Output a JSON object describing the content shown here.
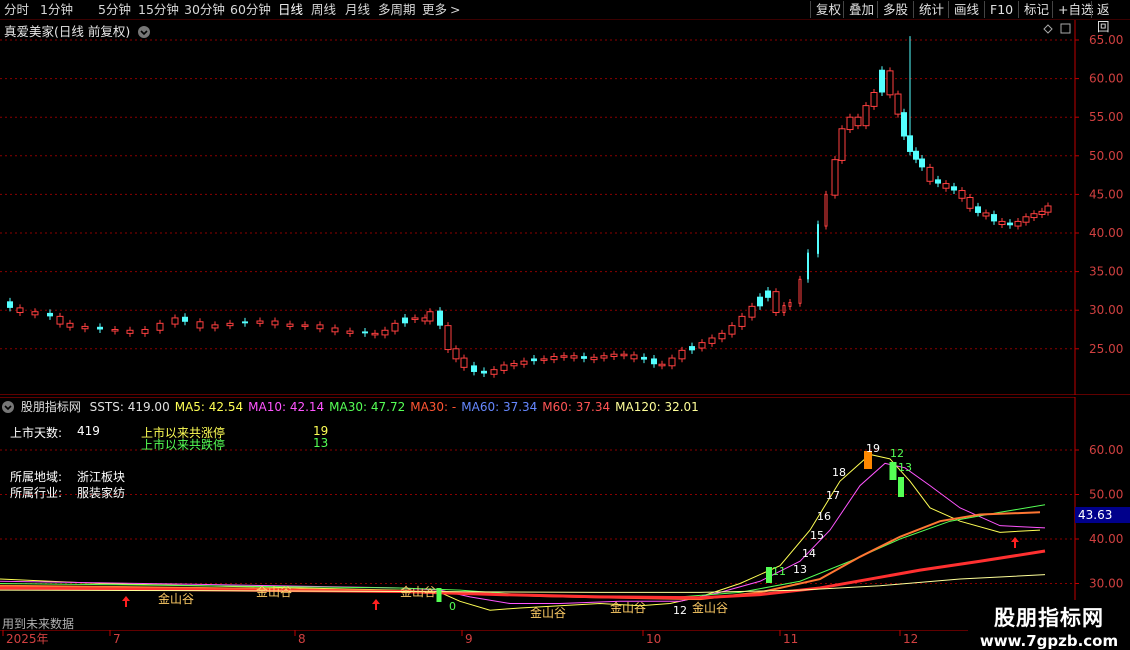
{
  "toolbar": {
    "periods": [
      "分时",
      "1分钟",
      "5分钟",
      "15分钟",
      "30分钟",
      "60分钟",
      "日线",
      "周线",
      "月线",
      "多周期",
      "更多"
    ],
    "more_glyph": ">",
    "active": "日线",
    "right": [
      "复权",
      "叠加",
      "多股",
      "统计",
      "画线",
      "F10",
      "标记",
      "+自选",
      "返回"
    ]
  },
  "main_chart": {
    "title": "真爱美家(日线 前复权)",
    "ylabels": [
      "65.00",
      "60.00",
      "55.00",
      "50.00",
      "45.00",
      "40.00",
      "35.00",
      "30.00",
      "25.00"
    ]
  },
  "indicator": {
    "name": "股朋指标网",
    "values": [
      {
        "label": "SSTS: 419.00",
        "color": "#e0e0e0"
      },
      {
        "label": "MA5: 42.54",
        "color": "#ffff55"
      },
      {
        "label": "MA10: 42.14",
        "color": "#ff55ff"
      },
      {
        "label": "MA30: 47.72",
        "color": "#55ff55"
      },
      {
        "label": "MA30: -",
        "color": "#ff5533"
      },
      {
        "label": "MA60: 37.34",
        "color": "#6688ff"
      },
      {
        "label": "M60: 37.34",
        "color": "#ff5555"
      },
      {
        "label": "MA120: 32.01",
        "color": "#ffff99"
      }
    ],
    "days_label": "上市天数:",
    "days_value": "419",
    "up_label": "上市以来共涨停",
    "up_value": "19",
    "down_label": "上市以来共跌停",
    "down_value": "13",
    "region_label": "所属地域:",
    "region_value": "浙江板块",
    "industry_label": "所属行业:",
    "industry_value": "服装家纺",
    "ylabels": [
      "60.00",
      "50.00",
      "40.00",
      "30.00"
    ],
    "current_value": "43.63",
    "annotations": [
      "金山谷",
      "金山谷",
      "金山谷",
      "金山谷",
      "金山谷",
      "金山谷",
      "金山谷"
    ],
    "nums": [
      "19",
      "18",
      "17",
      "16",
      "15",
      "14",
      "13",
      "12",
      "13",
      "11",
      "12",
      "0"
    ],
    "future_label": "用到未来数据"
  },
  "xaxis": {
    "labels": [
      "2025年",
      "7",
      "8",
      "9",
      "10",
      "11",
      "12"
    ]
  },
  "watermark": {
    "name": "股朋指标网",
    "url": "www.7gpzb.com"
  },
  "colors": {
    "up": "#ff4040",
    "down": "#54ffff",
    "grid": "#8b0000",
    "axis": "#c00000"
  }
}
